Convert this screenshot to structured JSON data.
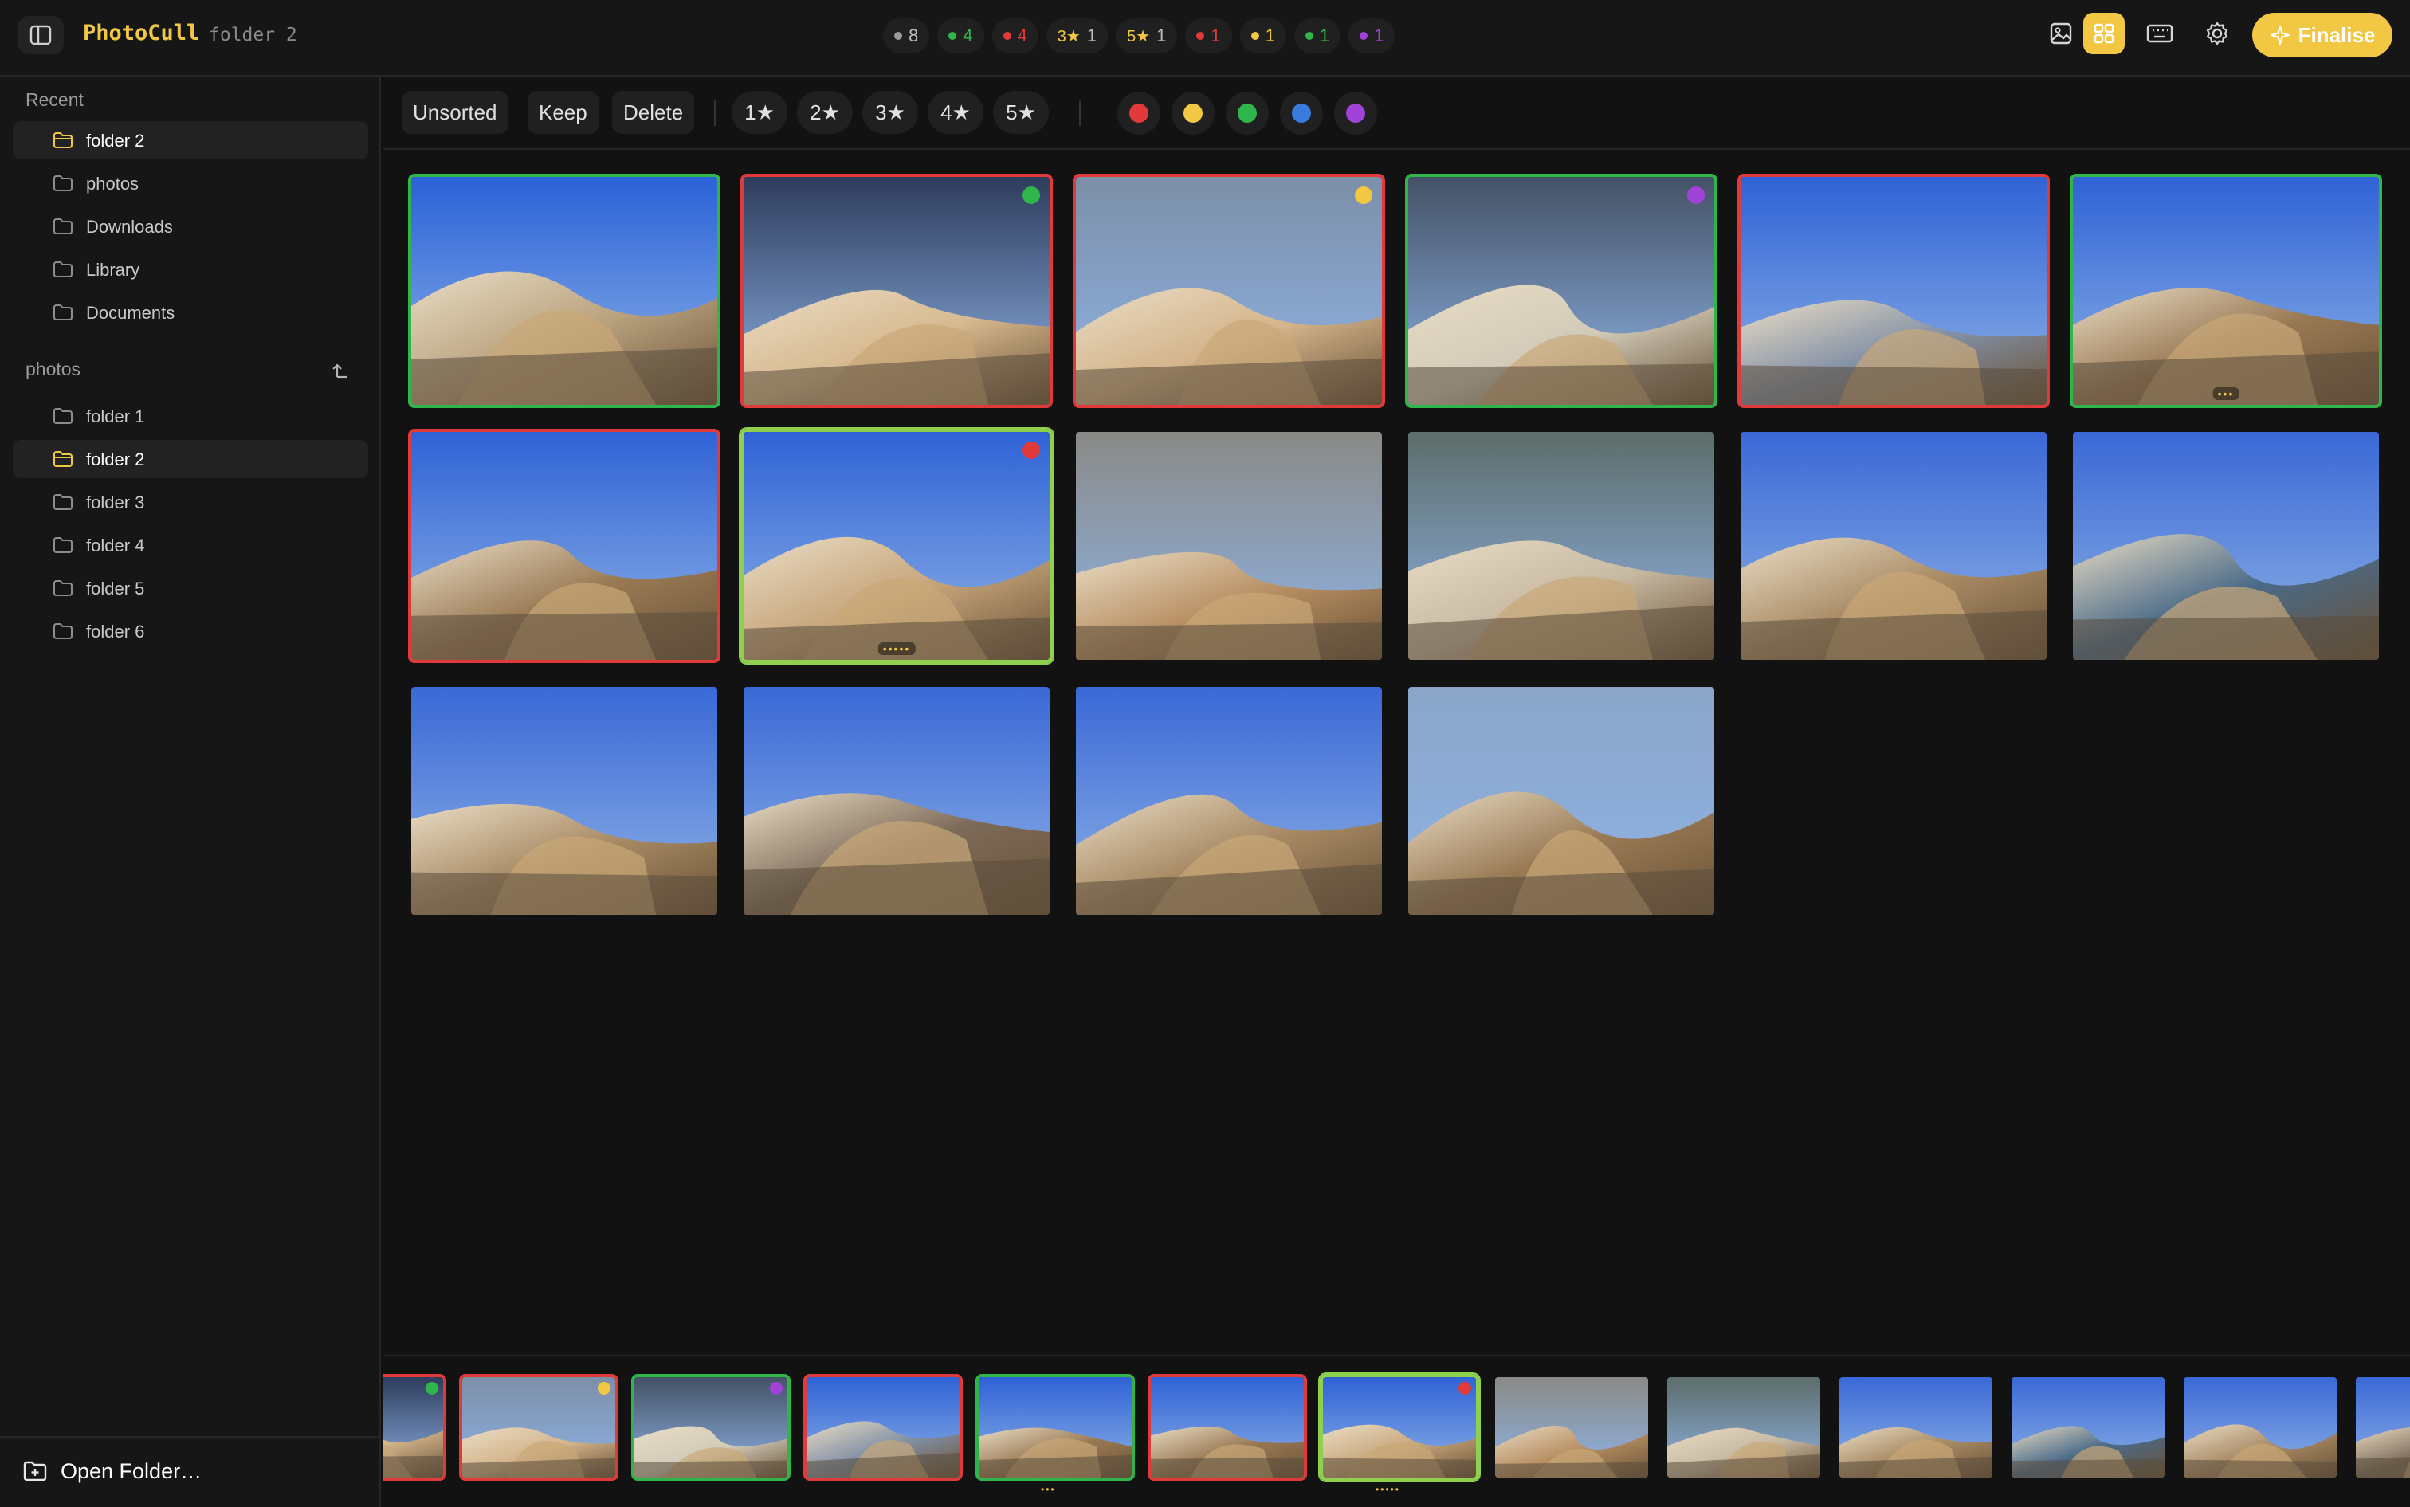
{
  "app": {
    "title": "PhotoCull",
    "folder": "folder 2"
  },
  "stats": [
    {
      "dot": "#9a9a9a",
      "value": "8"
    },
    {
      "dot": "#2fb54a",
      "value": "4"
    },
    {
      "dot": "#e03a3a",
      "value": "4"
    },
    {
      "star": "3★",
      "value": "1"
    },
    {
      "star": "5★",
      "value": "1"
    },
    {
      "dot": "#e03a3a",
      "value": "1"
    },
    {
      "dot": "#f2c744",
      "value": "1"
    },
    {
      "dot": "#2fb54a",
      "value": "1"
    },
    {
      "dot": "#a142d8",
      "value": "1"
    }
  ],
  "toolbar": {
    "finalise_label": "Finalise"
  },
  "sidebar": {
    "recent_heading": "Recent",
    "recent": [
      "folder 2",
      "photos",
      "Downloads",
      "Library",
      "Documents"
    ],
    "photos_heading": "photos",
    "folders": [
      "folder 1",
      "folder 2",
      "folder 3",
      "folder 4",
      "folder 5",
      "folder 6"
    ],
    "open_folder": "Open Folder…"
  },
  "filters": {
    "status": [
      "Unsorted",
      "Keep",
      "Delete"
    ],
    "stars": [
      "1★",
      "2★",
      "3★",
      "4★",
      "5★"
    ],
    "colors": [
      "#e03a3a",
      "#f2c744",
      "#2fb54a",
      "#3a7be0",
      "#a142d8"
    ]
  },
  "grid": [
    {
      "border": "green",
      "marker": null,
      "rating": "",
      "palette": [
        "#2a62d8",
        "#b9a27e"
      ]
    },
    {
      "border": "red",
      "marker": "#2fb54a",
      "rating": "",
      "palette": [
        "#2e3c5c",
        "#d7b98f"
      ]
    },
    {
      "border": "red",
      "marker": "#f2c744",
      "rating": "",
      "palette": [
        "#7c8fa8",
        "#d4b48b"
      ]
    },
    {
      "border": "green",
      "marker": "#a142d8",
      "rating": "",
      "palette": [
        "#445266",
        "#d2cbb9"
      ]
    },
    {
      "border": "red",
      "marker": null,
      "rating": "",
      "palette": [
        "#2f62d6",
        "#8290a6"
      ]
    },
    {
      "border": "green",
      "marker": null,
      "rating": "•••",
      "palette": [
        "#2f62d6",
        "#9a7a55"
      ]
    },
    {
      "border": "red",
      "marker": null,
      "rating": "",
      "palette": [
        "#2f62d6",
        "#9a7a55"
      ]
    },
    {
      "border": "selected",
      "marker": "#e03a3a",
      "rating": "•••••",
      "palette": [
        "#2f62d6",
        "#c7a57b"
      ]
    },
    {
      "border": "none",
      "marker": null,
      "rating": "",
      "palette": [
        "#8a8a86",
        "#b88f63"
      ]
    },
    {
      "border": "none",
      "marker": null,
      "rating": "",
      "palette": [
        "#5d6d6a",
        "#c7b9a2"
      ]
    },
    {
      "border": "none",
      "marker": null,
      "rating": "",
      "palette": [
        "#3a68d6",
        "#a88a64"
      ]
    },
    {
      "border": "none",
      "marker": null,
      "rating": "",
      "palette": [
        "#3a68d6",
        "#4a6a88"
      ]
    },
    {
      "border": "none",
      "marker": null,
      "rating": "",
      "palette": [
        "#3a68d6",
        "#a88a64"
      ]
    },
    {
      "border": "none",
      "marker": null,
      "rating": "",
      "palette": [
        "#3a68d6",
        "#7c6a58"
      ]
    },
    {
      "border": "none",
      "marker": null,
      "rating": "",
      "palette": [
        "#3a68d6",
        "#a88a64"
      ]
    },
    {
      "border": "none",
      "marker": null,
      "rating": "",
      "palette": [
        "#8aa5c8",
        "#9a7a55"
      ]
    }
  ],
  "filmstrip": [
    {
      "border": "red",
      "marker": "#2fb54a",
      "rating": ""
    },
    {
      "border": "red",
      "marker": "#f2c744",
      "rating": ""
    },
    {
      "border": "green",
      "marker": "#a142d8",
      "rating": ""
    },
    {
      "border": "red",
      "marker": null,
      "rating": ""
    },
    {
      "border": "green",
      "marker": null,
      "rating": "•••"
    },
    {
      "border": "red",
      "marker": null,
      "rating": ""
    },
    {
      "border": "selected",
      "marker": "#e03a3a",
      "rating": "•••••"
    },
    {
      "border": "none",
      "marker": null,
      "rating": ""
    },
    {
      "border": "none",
      "marker": null,
      "rating": ""
    },
    {
      "border": "none",
      "marker": null,
      "rating": ""
    },
    {
      "border": "none",
      "marker": null,
      "rating": ""
    },
    {
      "border": "none",
      "marker": null,
      "rating": ""
    },
    {
      "border": "none",
      "marker": null,
      "rating": ""
    }
  ]
}
